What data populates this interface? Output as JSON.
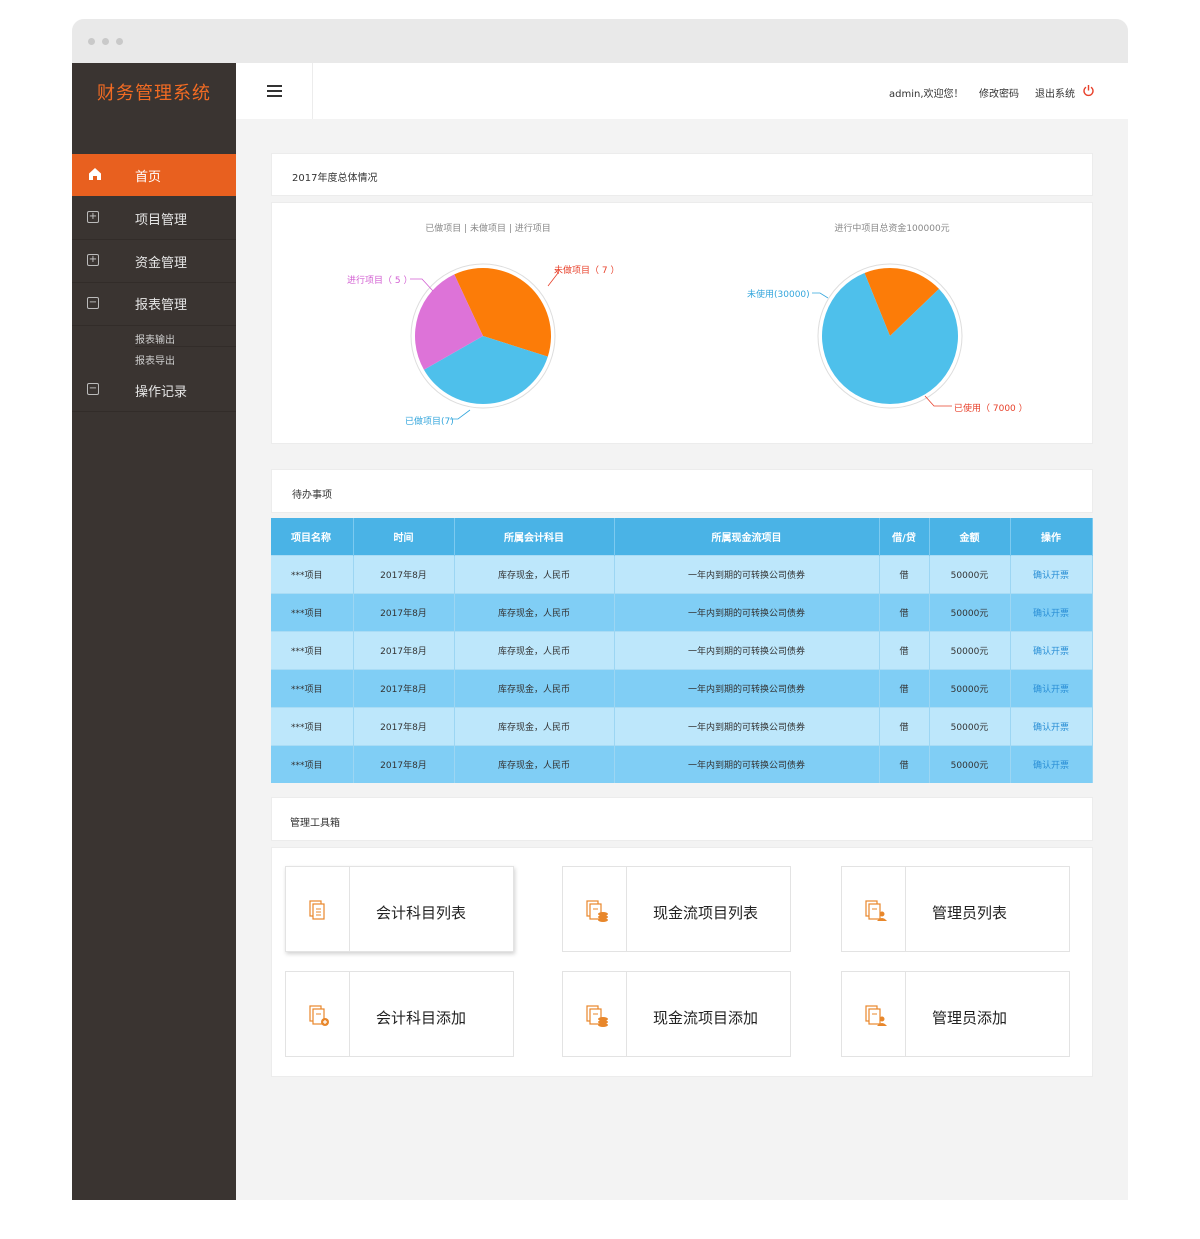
{
  "app": {
    "title": "财务管理系统"
  },
  "topbar": {
    "welcome": "admin,欢迎您！",
    "change_password": "修改密码",
    "logout": "退出系统"
  },
  "sidebar": {
    "items": [
      {
        "label": "首页",
        "icon": "home-icon",
        "active": true
      },
      {
        "label": "项目管理",
        "icon": "plus-box-icon"
      },
      {
        "label": "资金管理",
        "icon": "plus-box-icon"
      },
      {
        "label": "报表管理",
        "icon": "minus-box-icon"
      },
      {
        "label": "操作记录",
        "icon": "minus-box-icon"
      }
    ],
    "submenu": [
      "报表输出",
      "报表导出"
    ]
  },
  "overview": {
    "title": "2017年度总体情况"
  },
  "chart_data": [
    {
      "type": "pie",
      "title": "已做项目 | 未做项目 | 进行项目",
      "slices": [
        {
          "label": "未做项目（ 7 ）",
          "value": 7,
          "color": "#fc7c08"
        },
        {
          "label": "已做项目(7)",
          "value": 7,
          "color": "#4ec0eb"
        },
        {
          "label": "进行项目（ 5 ）",
          "value": 5,
          "color": "#dd73d8"
        }
      ]
    },
    {
      "type": "pie",
      "title": "进行中项目总资金100000元",
      "slices": [
        {
          "label": "已使用（ 7000 ）",
          "value": 7000,
          "color": "#fc7c08"
        },
        {
          "label": "未使用(30000)",
          "value": 30000,
          "color": "#4ec0eb"
        }
      ]
    }
  ],
  "todo": {
    "title": "待办事项",
    "columns": [
      "项目名称",
      "时间",
      "所属会计科目",
      "所属现金流项目",
      "借/贷",
      "金额",
      "操作"
    ],
    "rows": [
      [
        "***项目",
        "2017年8月",
        "库存现金，人民币",
        "一年内到期的可转换公司债券",
        "借",
        "50000元",
        "确认开票"
      ],
      [
        "***项目",
        "2017年8月",
        "库存现金，人民币",
        "一年内到期的可转换公司债券",
        "借",
        "50000元",
        "确认开票"
      ],
      [
        "***项目",
        "2017年8月",
        "库存现金，人民币",
        "一年内到期的可转换公司债券",
        "借",
        "50000元",
        "确认开票"
      ],
      [
        "***项目",
        "2017年8月",
        "库存现金，人民币",
        "一年内到期的可转换公司债券",
        "借",
        "50000元",
        "确认开票"
      ],
      [
        "***项目",
        "2017年8月",
        "库存现金，人民币",
        "一年内到期的可转换公司债券",
        "借",
        "50000元",
        "确认开票"
      ],
      [
        "***项目",
        "2017年8月",
        "库存现金，人民币",
        "一年内到期的可转换公司债券",
        "借",
        "50000元",
        "确认开票"
      ]
    ]
  },
  "toolbox": {
    "title": "管理工具箱",
    "tools": [
      {
        "label": "会计科目列表",
        "icon": "document-list-icon"
      },
      {
        "label": "现金流项目列表",
        "icon": "document-coins-icon"
      },
      {
        "label": "管理员列表",
        "icon": "document-user-icon"
      },
      {
        "label": "会计科目添加",
        "icon": "document-add-icon"
      },
      {
        "label": "现金流项目添加",
        "icon": "document-coins-icon"
      },
      {
        "label": "管理员添加",
        "icon": "document-user-icon"
      }
    ]
  },
  "colors": {
    "accent": "#e8601f",
    "sidebar_bg": "#3a3431",
    "table_header": "#4ab3e6",
    "row_light": "#bde7fb",
    "row_dark": "#80cef5",
    "icon_orange": "#e8872b"
  }
}
